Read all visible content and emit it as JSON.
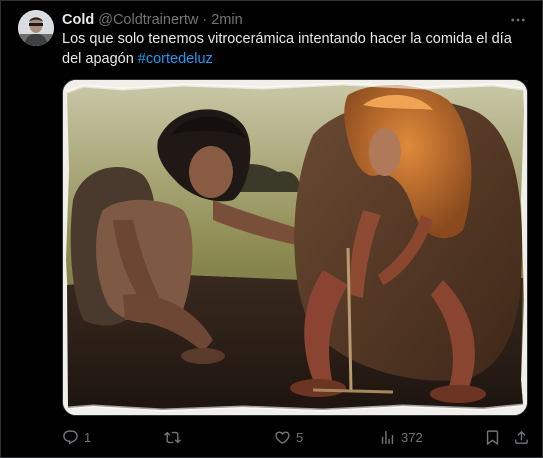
{
  "author": {
    "name": "Cold",
    "handle": "@Coldtrainertw",
    "separator": "·",
    "time": "2min"
  },
  "post": {
    "text": "Los que solo tenemos vitrocerámica intentando hacer la comida el día del apagón ",
    "hashtag": "#cortedeluz"
  },
  "actions": {
    "replies": "1",
    "reposts": "",
    "likes": "5",
    "views": "372"
  },
  "colors": {
    "background": "#000000",
    "text": "#e7e9ea",
    "muted": "#71767b",
    "accent": "#1d9bf0",
    "border": "#2f3336"
  },
  "icons": [
    "avatar",
    "more-icon",
    "reply-icon",
    "repost-icon",
    "like-icon",
    "views-icon",
    "bookmark-icon",
    "share-icon"
  ]
}
